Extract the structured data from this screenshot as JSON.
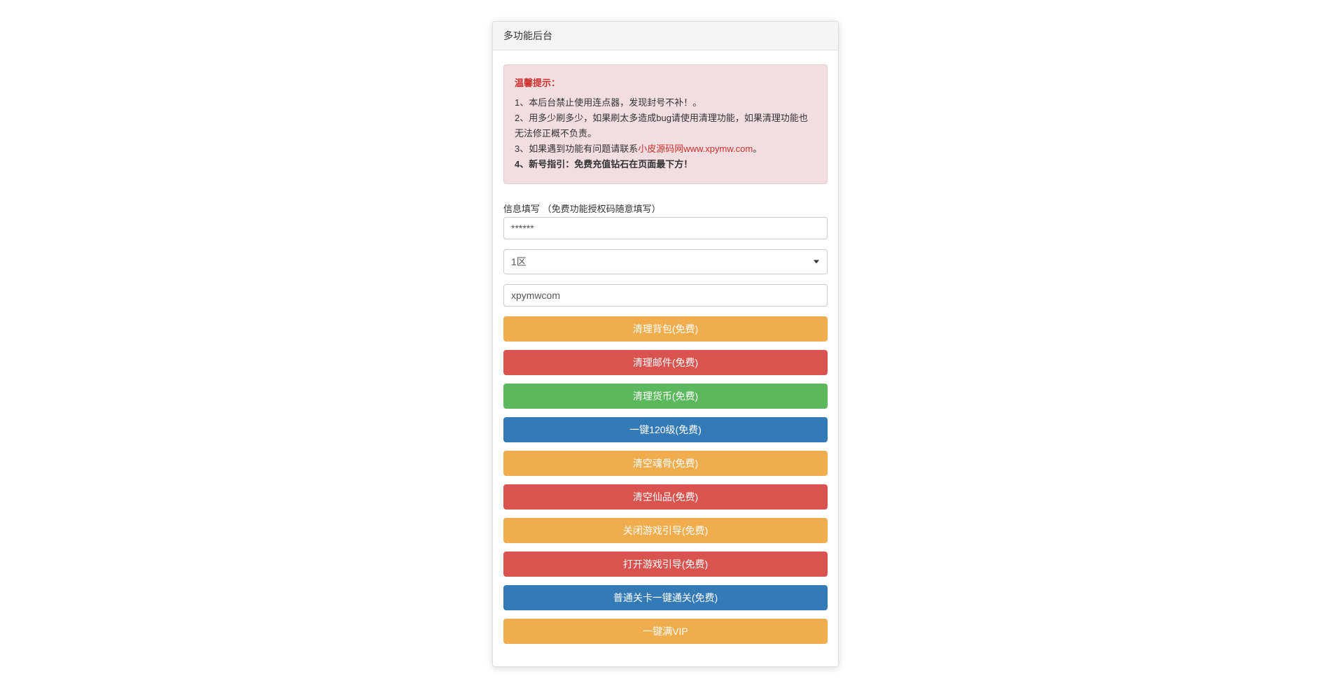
{
  "panel": {
    "title": "多功能后台"
  },
  "alert": {
    "title": "温馨提示：",
    "line1": "1、本后台禁止使用连点器，发现封号不补！。",
    "line2": "2、用多少刷多少，如果刷太多造成bug请使用清理功能，如果清理功能也无法修正概不负责。",
    "line3_prefix": "3、如果遇到功能有问题请联系",
    "line3_link": "小皮源码网www.xpymw.com",
    "line3_suffix": "。",
    "line4": "4、新号指引：免费充值钻石在页面最下方！"
  },
  "form": {
    "label": "信息填写 （免费功能授权码随意填写）",
    "code_value": "******",
    "zone_value": "1区",
    "username_value": "xpymwcom"
  },
  "buttons": {
    "b1": "清理背包(免费)",
    "b2": "清理邮件(免费)",
    "b3": "清理货币(免费)",
    "b4": "一键120级(免费)",
    "b5": "清空魂骨(免费)",
    "b6": "清空仙品(免费)",
    "b7": "关闭游戏引导(免费)",
    "b8": "打开游戏引导(免费)",
    "b9": "普通关卡一键通关(免费)",
    "b10": "一键满VIP"
  }
}
